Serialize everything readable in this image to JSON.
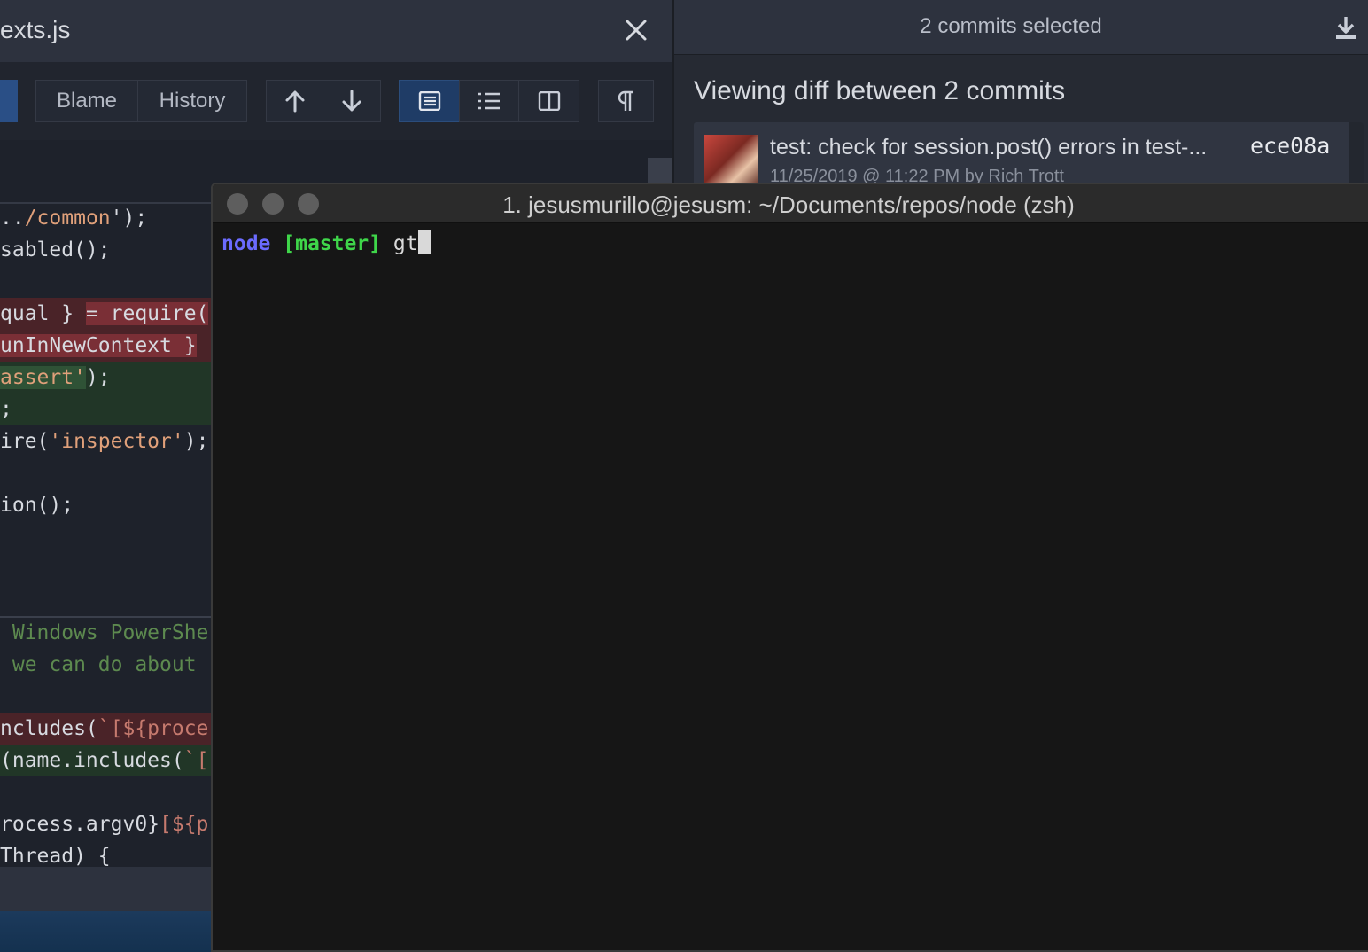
{
  "editor": {
    "filename": "exts.js",
    "close_icon": "close-icon",
    "toolbar": {
      "blame_label": "Blame",
      "history_label": "History",
      "icons": [
        "arrow-up-icon",
        "arrow-down-icon",
        "unified-view-icon",
        "list-view-icon",
        "split-view-icon",
        "pilcrow-icon"
      ]
    },
    "code_lines": [
      {
        "parts": [
          "..",
          "/common",
          "');"
        ]
      },
      {
        "parts": [
          "sabled();"
        ]
      },
      {
        "parts": [
          "qual } ",
          "= require("
        ]
      },
      {
        "parts": [
          "unInNewContext }"
        ]
      },
      {
        "parts": [
          "assert'",
          ");"
        ]
      },
      {
        "parts": [
          ";"
        ]
      },
      {
        "parts": [
          "ire(",
          "'inspector'",
          ");"
        ]
      },
      {
        "parts": [
          "ion();"
        ]
      },
      {
        "parts": [
          " Windows PowerShe"
        ]
      },
      {
        "parts": [
          " we can do about"
        ]
      },
      {
        "parts": [
          "ncludes(",
          "`[${proce"
        ]
      },
      {
        "parts": [
          "(name.includes(",
          "`["
        ]
      },
      {
        "parts": [
          "rocess.argv0}",
          "[${p"
        ]
      },
      {
        "parts": [
          "Thread) {"
        ]
      }
    ]
  },
  "commits": {
    "header": "2 commits selected",
    "download_icon": "download-icon",
    "diff_title": "Viewing diff between 2 commits",
    "card": {
      "message": "test: check for session.post() errors in test-...",
      "meta": "11/25/2019 @ 11:22 PM by Rich Trott",
      "sha": "ece08a"
    }
  },
  "terminal": {
    "title": "1. jesusmurillo@jesusm: ~/Documents/repos/node (zsh)",
    "prompt_dir": "node",
    "prompt_branch": "[master]",
    "command": "gt"
  },
  "colors": {
    "deleted_line": "#4a2328",
    "added_line": "#213627",
    "prompt_dir": "#6b6bff",
    "prompt_branch": "#3fd64a"
  }
}
